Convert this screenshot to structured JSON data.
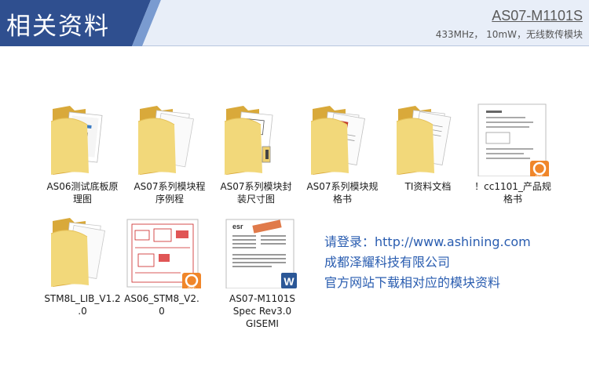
{
  "header": {
    "title": "相关资料",
    "model": "AS07-M1101S",
    "subtitle": "433MHz， 10mW，无线数传模块",
    "colors": {
      "band": "#2f4f8f",
      "band_light": "#5b84c6",
      "background": "#ffffff"
    }
  },
  "files": [
    {
      "name": "AS06测试底板原\n理图",
      "type": "folder",
      "icon": "folder-icon"
    },
    {
      "name": "AS07系列模块程\n序例程",
      "type": "folder",
      "icon": "folder-icon"
    },
    {
      "name": "AS07系列模块封\n装尺寸图",
      "type": "folder",
      "icon": "folder-icon"
    },
    {
      "name": "AS07系列模块规\n格书",
      "type": "folder",
      "icon": "folder-icon"
    },
    {
      "name": "TI资料文档",
      "type": "folder",
      "icon": "folder-icon"
    },
    {
      "name": "！cc1101_产品规\n格书",
      "type": "pdf",
      "icon": "pdf-file-icon"
    },
    {
      "name": "STM8L_LIB_V1.2\n.0",
      "type": "folder",
      "icon": "folder-icon"
    },
    {
      "name": "AS06_STM8_V2.\n0",
      "type": "pdf",
      "icon": "pdf-file-icon"
    },
    {
      "name": "AS07-M1101S\nSpec Rev3.0\nGISEMI",
      "type": "word",
      "icon": "word-file-icon"
    }
  ],
  "contact": {
    "website": "请登录：http://www.ashining.com",
    "company": "成都泽耀科技有限公司",
    "note": "官方网站下载相对应的模块资料",
    "color": "#2a5db0"
  }
}
